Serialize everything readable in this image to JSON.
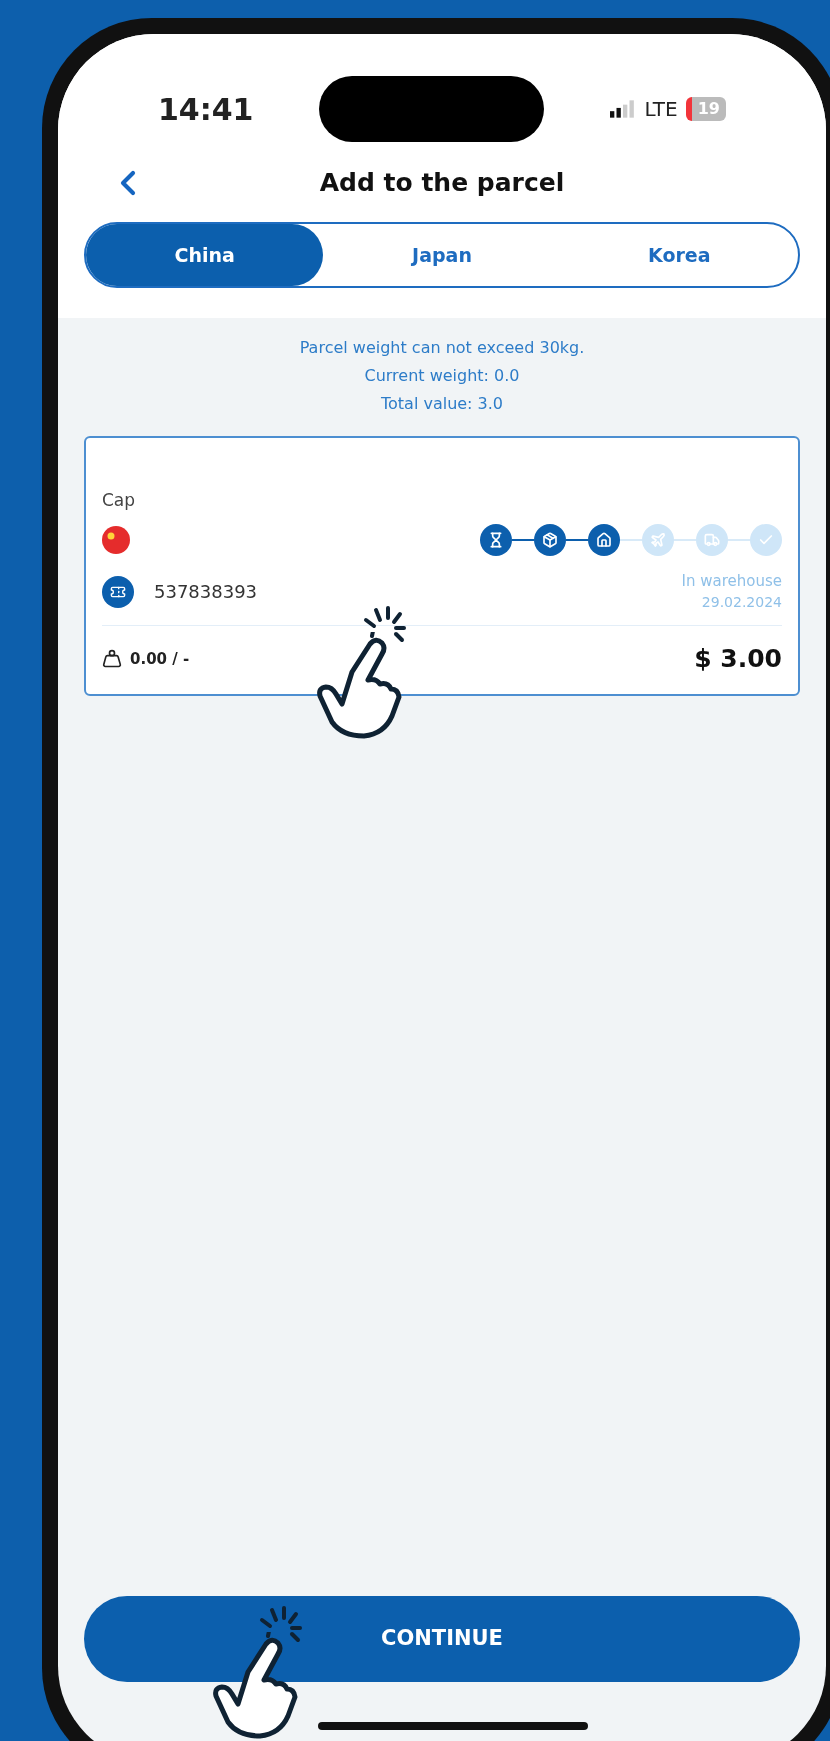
{
  "status_bar": {
    "time": "14:41",
    "network": "LTE",
    "battery": "19"
  },
  "header": {
    "title": "Add to the parcel"
  },
  "tabs": [
    {
      "label": "China",
      "selected": true
    },
    {
      "label": "Japan",
      "selected": false
    },
    {
      "label": "Korea",
      "selected": false
    }
  ],
  "info": [
    "Parcel weight can not exceed 30kg.",
    "Current weight: 0.0",
    "Total value: 3.0"
  ],
  "card": {
    "name": "Cap",
    "tracking": "537838393",
    "status": "In warehouse",
    "date": "29.02.2024",
    "weight": "0.00 / -",
    "price": "$ 3.00",
    "steps": [
      {
        "done": true
      },
      {
        "done": true
      },
      {
        "done": true
      },
      {
        "done": false
      },
      {
        "done": false
      },
      {
        "done": false
      }
    ]
  },
  "continue_button": "CONTINUE"
}
